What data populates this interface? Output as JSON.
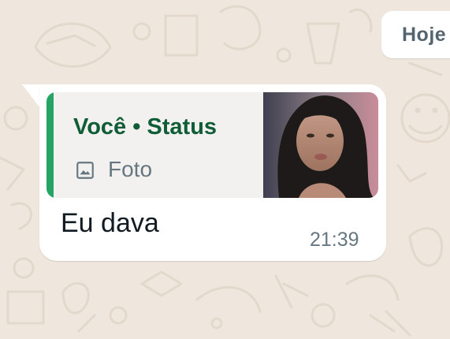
{
  "date_chip": {
    "label": "Hoje"
  },
  "message": {
    "quoted": {
      "author": "Você • Status",
      "media_type": "Foto",
      "media_icon": "photo-icon",
      "accent_color": "#25a464"
    },
    "text": "Eu dava",
    "time": "21:39"
  },
  "colors": {
    "wallpaper": "#efe7dd",
    "bubble": "#ffffff",
    "quote_background": "#f3f1ef",
    "quote_author": "#0f5c36",
    "meta_text": "#667781"
  }
}
